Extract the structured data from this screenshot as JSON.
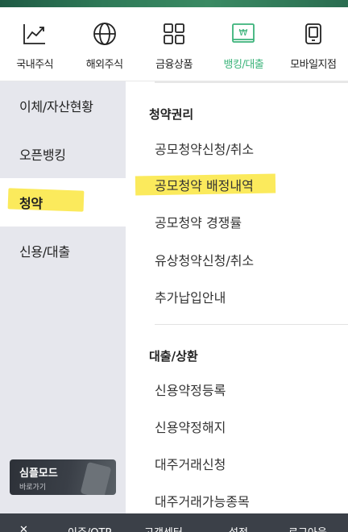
{
  "categories": [
    {
      "label": "국내주식",
      "icon": "chart-line-icon",
      "active": false
    },
    {
      "label": "해외주식",
      "icon": "globe-icon",
      "active": false
    },
    {
      "label": "금융상품",
      "icon": "grid-icon",
      "active": false
    },
    {
      "label": "뱅킹/대출",
      "icon": "won-card-icon",
      "active": true
    },
    {
      "label": "모바일지점",
      "icon": "mobile-icon",
      "active": false
    }
  ],
  "sidebar": {
    "items": [
      {
        "label": "이체/자산현황"
      },
      {
        "label": "오픈뱅킹"
      },
      {
        "label": "청약"
      },
      {
        "label": "신용/대출"
      }
    ],
    "simple_mode": {
      "title": "심플모드",
      "subtitle": "바로가기"
    }
  },
  "main": {
    "sections": [
      {
        "title": "청약권리",
        "items": [
          {
            "label": "공모청약신청/취소"
          },
          {
            "label": "공모청약 배정내역"
          },
          {
            "label": "공모청약 경쟁률"
          },
          {
            "label": "유상청약신청/취소"
          },
          {
            "label": "추가납입안내"
          }
        ]
      },
      {
        "title": "대출/상환",
        "items": [
          {
            "label": "신용약정등록"
          },
          {
            "label": "신용약정해지"
          },
          {
            "label": "대주거래신청"
          },
          {
            "label": "대주거래가능종목"
          }
        ]
      }
    ]
  },
  "bottom_bar": {
    "items": [
      "✕",
      "이주/OTP",
      "고객센터",
      "설정",
      "로그아웃"
    ]
  },
  "colors": {
    "accent": "#3bb37a",
    "highlight": "#fbe84a",
    "sidebar_bg": "#e6e7ed",
    "bottom_bar": "#3b4048"
  }
}
